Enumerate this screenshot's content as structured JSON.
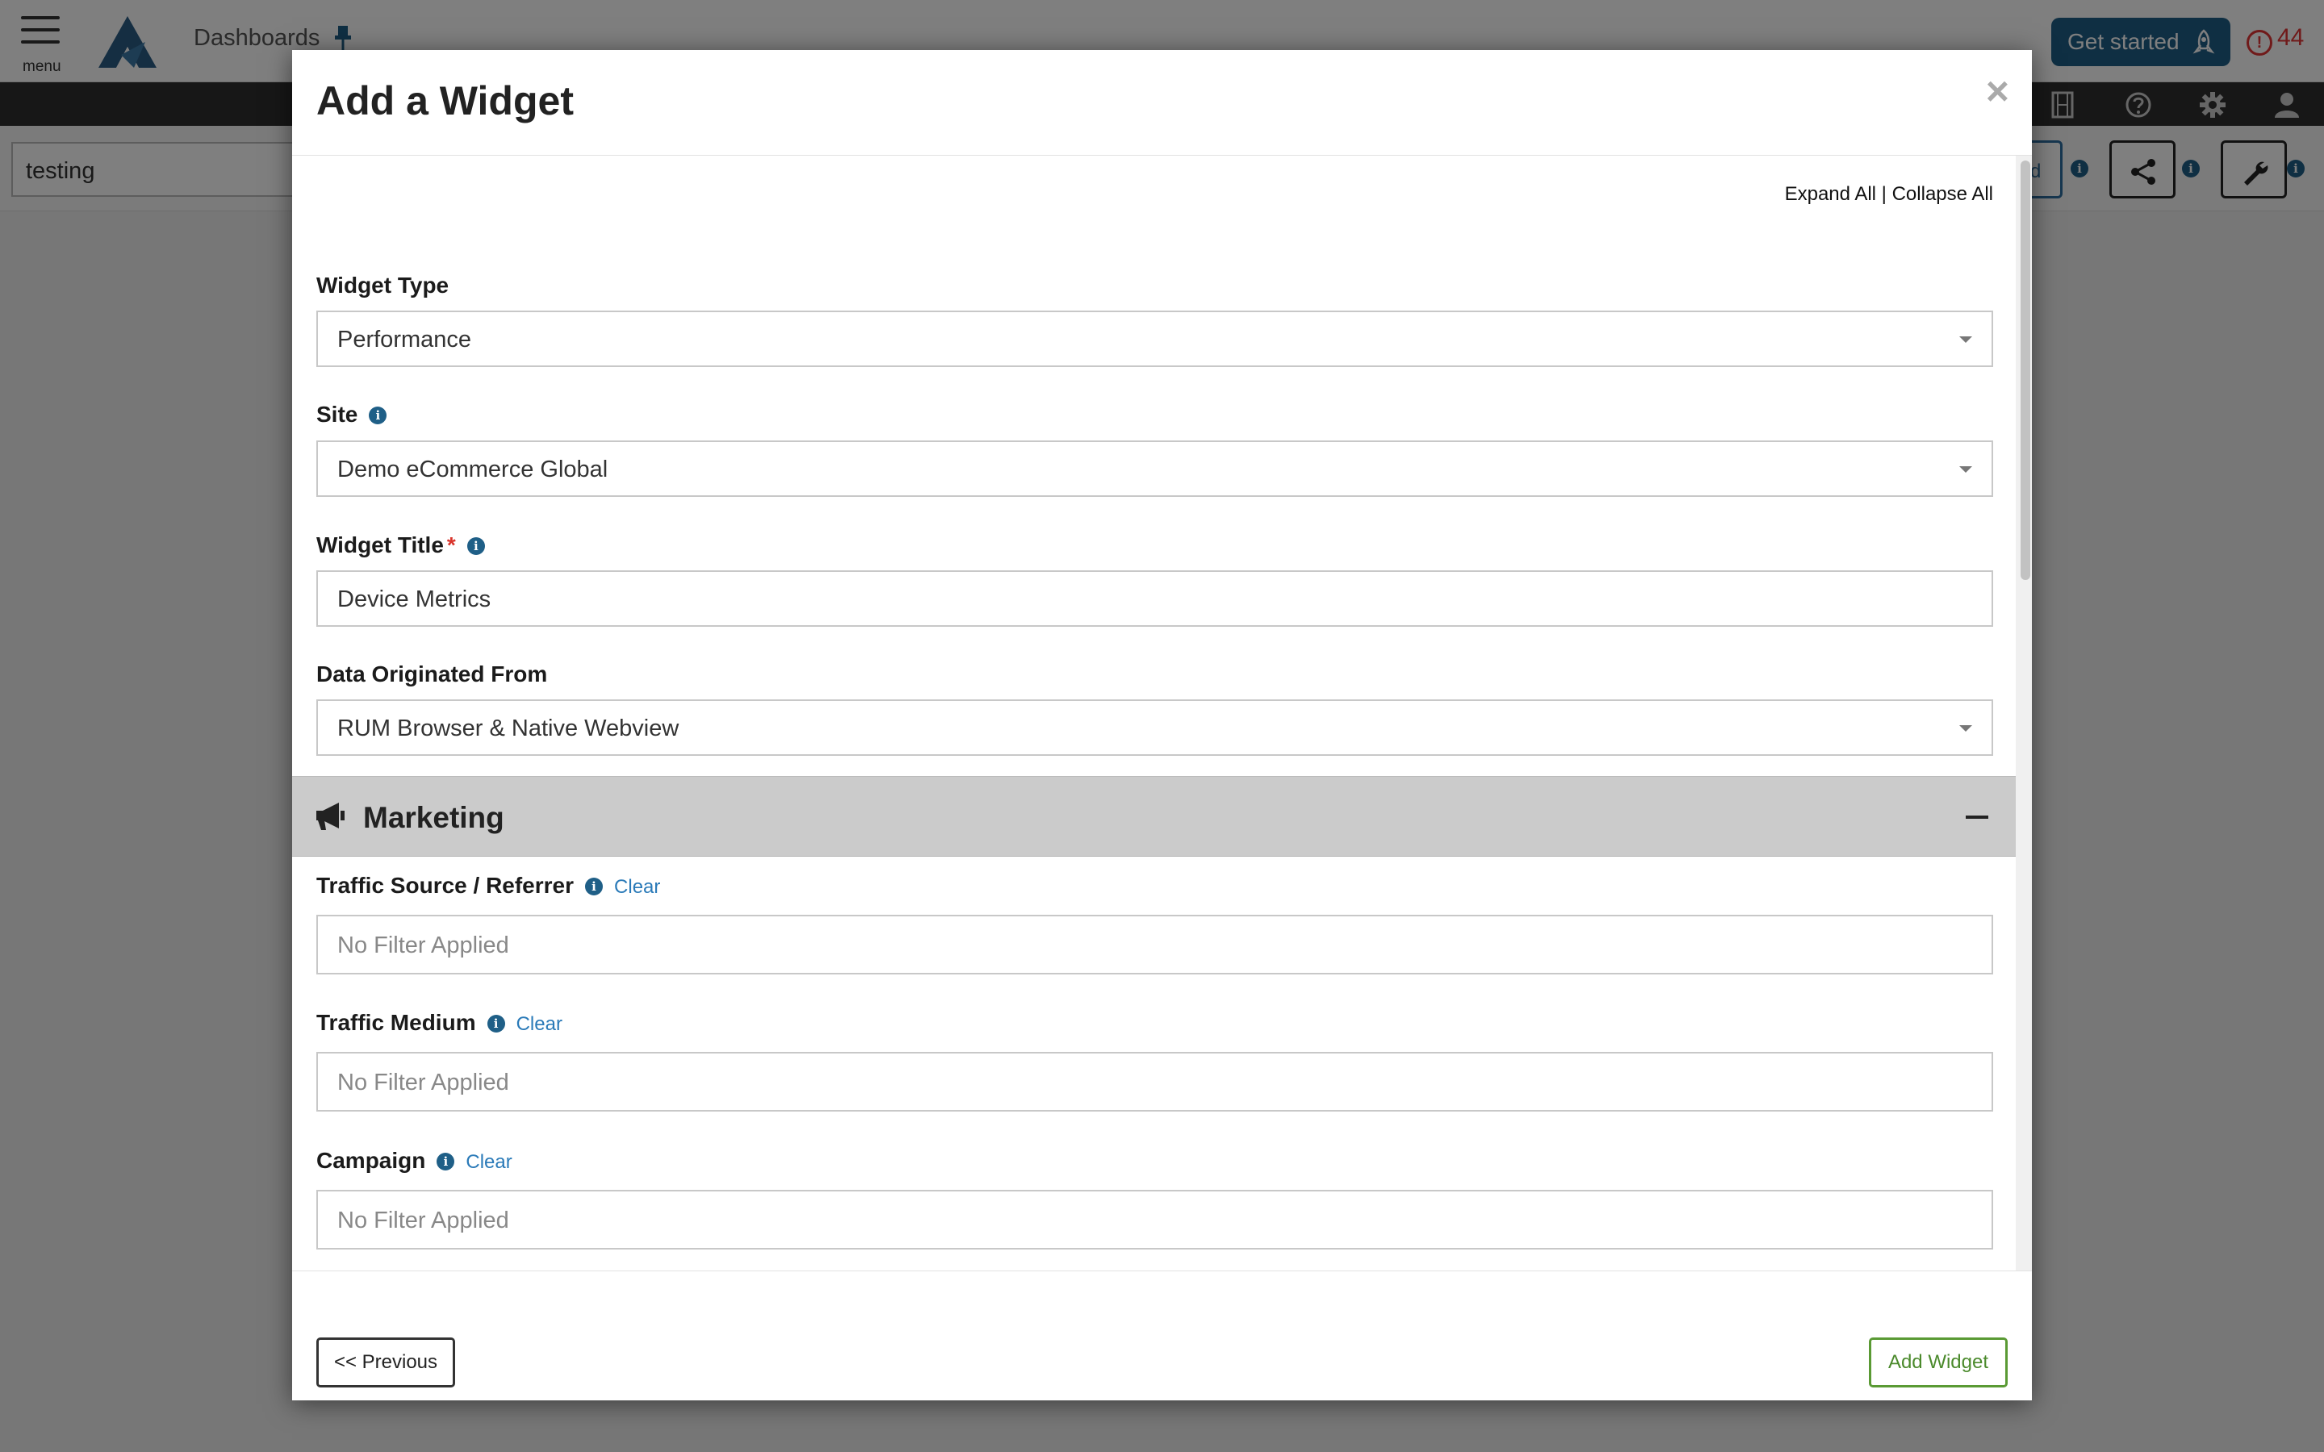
{
  "app": {
    "menu_label": "menu",
    "title": "Dashboards",
    "get_started_label": "Get started",
    "alert_count": "44",
    "dashboard_name": "testing",
    "partial_button_text": "d",
    "accent_color": "#1f5f87",
    "alert_color": "#e03434"
  },
  "modal": {
    "title": "Add a Widget",
    "close_symbol": "×",
    "expand_all": "Expand All",
    "separator": " | ",
    "collapse_all": "Collapse All",
    "fields": {
      "widget_type": {
        "label": "Widget Type",
        "value": "Performance"
      },
      "site": {
        "label": "Site",
        "value": "Demo eCommerce Global"
      },
      "widget_title": {
        "label": "Widget Title",
        "required_mark": "*",
        "value": "Device Metrics"
      },
      "data_origin": {
        "label": "Data Originated From",
        "value": "RUM Browser & Native Webview"
      }
    },
    "section": {
      "title": "Marketing",
      "icon": "megaphone-icon",
      "collapse_symbol": "minus"
    },
    "filters": {
      "clear_label": "Clear",
      "traffic_source": {
        "label": "Traffic Source / Referrer",
        "placeholder": "No Filter Applied"
      },
      "traffic_medium": {
        "label": "Traffic Medium",
        "placeholder": "No Filter Applied"
      },
      "campaign": {
        "label": "Campaign",
        "placeholder": "No Filter Applied"
      }
    },
    "footer": {
      "previous_label": "<< Previous",
      "add_label": "Add Widget",
      "add_color": "#5a9a34"
    }
  }
}
